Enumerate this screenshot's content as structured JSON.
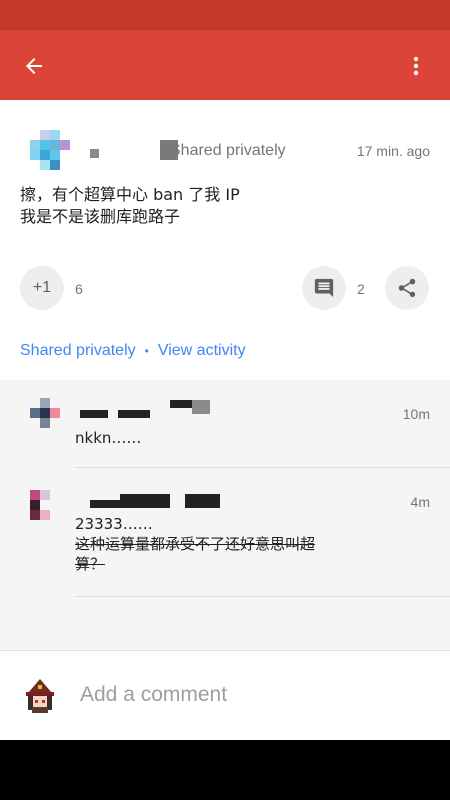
{
  "post": {
    "visibility": "Shared privately",
    "time": "17 min. ago",
    "text_line1": "擦，有个超算中心 ban 了我 IP",
    "text_line2": "我是不是该删库跑路子",
    "plus_label": "+1",
    "plus_count": "6",
    "comment_count": "2",
    "link_shared": "Shared privately",
    "link_separator": "•",
    "link_activity": "View activity"
  },
  "comments": [
    {
      "time": "10m",
      "text": "nkkn……"
    },
    {
      "time": "4m",
      "text_line1": "23333……",
      "text_line2": "这种运算量都承受不了还好意思叫超",
      "text_line3": "算？"
    }
  ],
  "composer": {
    "placeholder": "Add a comment"
  },
  "colors": {
    "app_bar": "#db4437",
    "status_bar": "#c53929",
    "link": "#4285f4"
  },
  "icons": {
    "back": "arrow-back-icon",
    "menu": "more-vert-icon",
    "comment": "comment-icon",
    "share": "share-icon"
  }
}
